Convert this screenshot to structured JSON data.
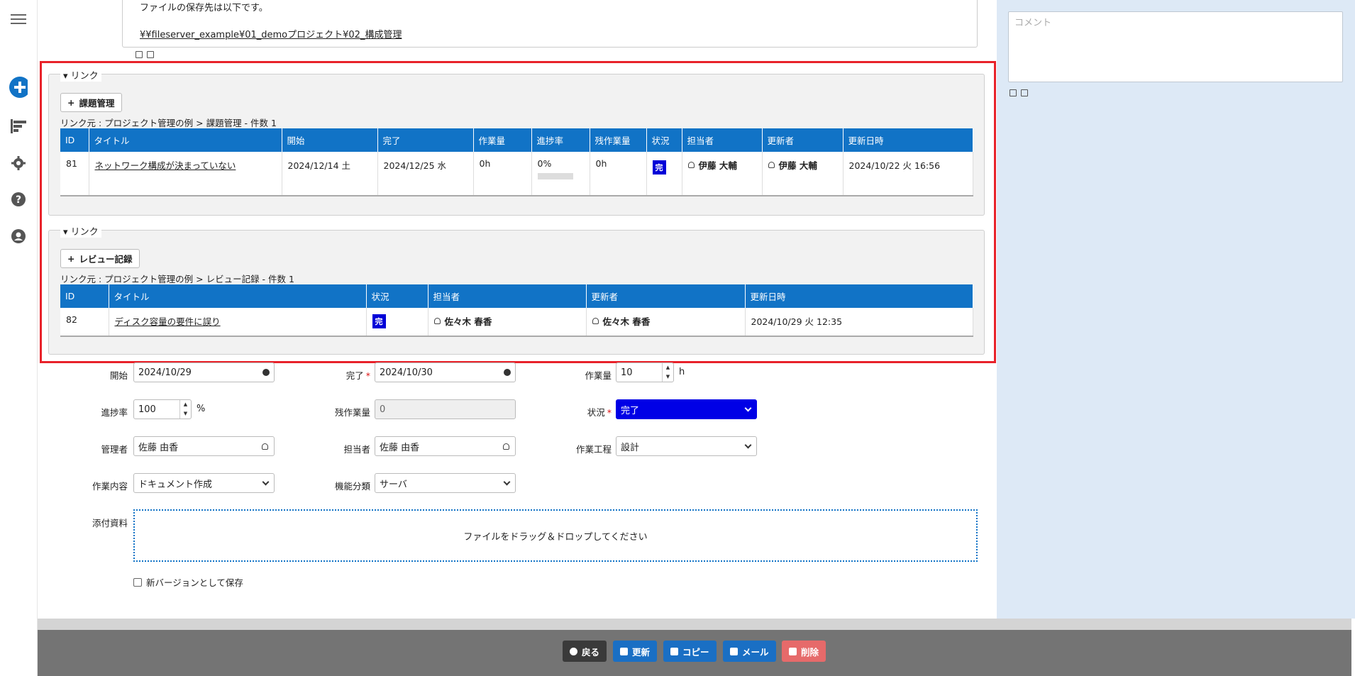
{
  "description": {
    "text": "ファイルの保存先は以下です。",
    "link": "¥¥fileserver_example¥01_demoプロジェクト¥02_構成管理"
  },
  "comment": {
    "placeholder": "コメント"
  },
  "link_sections": [
    {
      "legend": "リンク",
      "add_label": "課題管理",
      "crumb": "リンク元 : プロジェクト管理の例 > 課題管理 - 件数 1",
      "columns": [
        "ID",
        "タイトル",
        "開始",
        "完了",
        "作業量",
        "進捗率",
        "残作業量",
        "状況",
        "担当者",
        "更新者",
        "更新日時"
      ],
      "row": {
        "id": "81",
        "title": "ネットワーク構成が決まっていない",
        "start": "2024/12/14 土",
        "end": "2024/12/25 水",
        "workload": "0h",
        "progress": "0%",
        "progress_value": 0,
        "remaining": "0h",
        "status": "完",
        "assignee": "伊藤 大輔",
        "updater": "伊藤 大輔",
        "updated": "2024/10/22 火 16:56"
      }
    },
    {
      "legend": "リンク",
      "add_label": "レビュー記録",
      "crumb": "リンク元 : プロジェクト管理の例 > レビュー記録 - 件数 1",
      "columns": [
        "ID",
        "タイトル",
        "状況",
        "担当者",
        "更新者",
        "更新日時"
      ],
      "row": {
        "id": "82",
        "title": "ディスク容量の要件に誤り",
        "status": "完",
        "assignee": "佐々木 春香",
        "updater": "佐々木 春香",
        "updated": "2024/10/29 火 12:35"
      }
    }
  ],
  "form": {
    "start_label": "開始",
    "start_value": "2024/10/29",
    "end_label": "完了",
    "end_value": "2024/10/30",
    "workload_label": "作業量",
    "workload_value": "10",
    "workload_unit": "h",
    "progress_label": "進捗率",
    "progress_value": "100",
    "progress_unit": "%",
    "remaining_label": "残作業量",
    "remaining_value": "0",
    "status_label": "状況",
    "status_value": "完了",
    "manager_label": "管理者",
    "manager_value": "佐藤 由香",
    "assignee_label": "担当者",
    "assignee_value": "佐藤 由香",
    "process_label": "作業工程",
    "process_value": "設計",
    "content_label": "作業内容",
    "content_value": "ドキュメント作成",
    "category_label": "機能分類",
    "category_value": "サーバ",
    "attach_label": "添付資料",
    "dropzone_text": "ファイルをドラッグ＆ドロップしてください",
    "new_version_label": "新バージョンとして保存"
  },
  "footer": {
    "back": "戻る",
    "update": "更新",
    "copy": "コピー",
    "mail": "メール",
    "delete": "削除"
  },
  "colors": {
    "header_blue": "#1173c6",
    "status_blue": "#0000d8",
    "highlight_red": "#e8222a",
    "update_btn": "#1a6fc4",
    "delete_btn": "#e66a6a",
    "back_btn": "#3a3a3a"
  }
}
